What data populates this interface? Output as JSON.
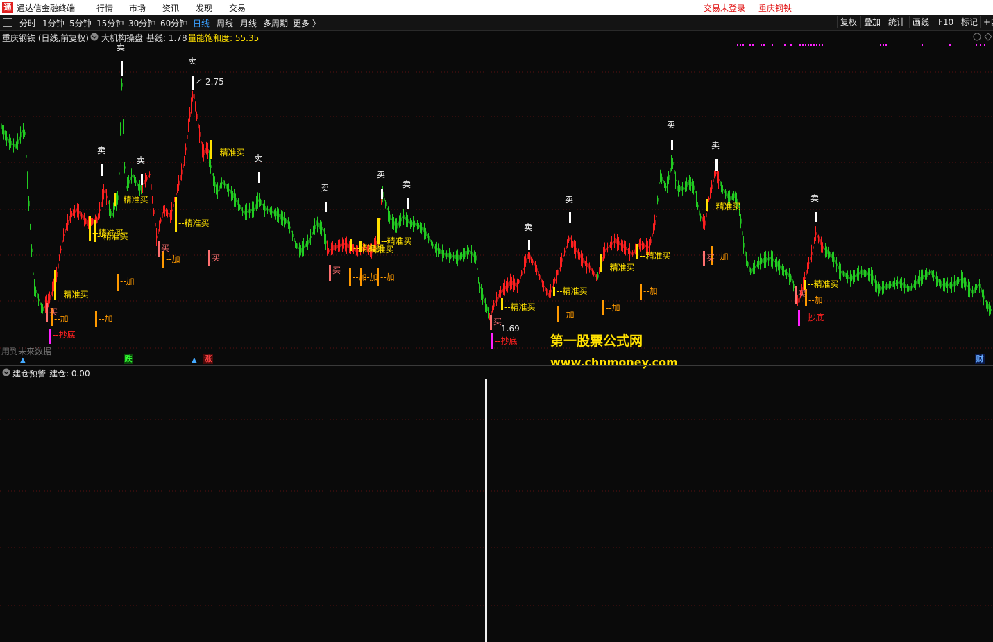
{
  "app": {
    "name": "通达信金融终端",
    "logo": "通"
  },
  "menu": [
    "行情",
    "市场",
    "资讯",
    "发现",
    "交易"
  ],
  "top_right": [
    "交易未登录",
    "重庆钢铁"
  ],
  "periods": [
    "分时",
    "1分钟",
    "5分钟",
    "15分钟",
    "30分钟",
    "60分钟",
    "日线",
    "周线",
    "月线",
    "多周期",
    "更多 〉"
  ],
  "active_period": "日线",
  "tools": [
    "复权",
    "叠加",
    "统计",
    "画线",
    "F10",
    "标记",
    "+自"
  ],
  "info": {
    "stock": "重庆钢铁 (日线,前复权)",
    "indicator": "大机构操盘",
    "base_label": "基线: 1.78",
    "energy_label": "量能饱和度: 55.35"
  },
  "chart": {
    "high_label": "2.75",
    "low_label": "1.69",
    "future_text": "用到未来数据",
    "markers": {
      "down": "跌",
      "up": "涨",
      "finance": "财"
    },
    "sell": "卖",
    "precise_buy": "精准买",
    "add": "加",
    "buy": "买",
    "bottom": "抄底"
  },
  "colors": {
    "up": "#ff2020",
    "down": "#22cc22",
    "yellow": "#ffe000",
    "orange": "#ff9900",
    "magenta": "#ff20ff",
    "pink": "#ff7070"
  },
  "watermark": {
    "title": "第一股票公式网",
    "url": "www.chnmoney.com"
  },
  "sub": {
    "title": "建仓预警",
    "value_label": "建仓: 0.00"
  }
}
